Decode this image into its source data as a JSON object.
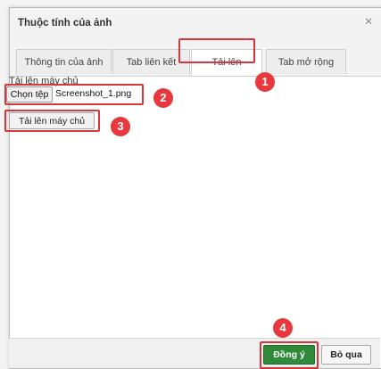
{
  "dialog": {
    "title": "Thuộc tính của ảnh",
    "close_glyph": "×",
    "close_icon": "close-icon"
  },
  "tabs": [
    {
      "label": "Thông tin của ảnh",
      "active": false
    },
    {
      "label": "Tab liên kết",
      "active": false
    },
    {
      "label": "Tải lên",
      "active": true
    },
    {
      "label": "Tab mở rộng",
      "active": false
    }
  ],
  "upload": {
    "label": "Tải lên máy chủ",
    "choose_button": "Chọn tệp",
    "file_name": "Screenshot_1.png",
    "server_button": "Tải lên máy chủ"
  },
  "footer": {
    "ok_label": "Đồng ý",
    "cancel_label": "Bỏ qua"
  },
  "step_badges": [
    "1",
    "2",
    "3",
    "4"
  ],
  "colors": {
    "highlight": "#d9363b",
    "badge": "#e8383d",
    "ok_button": "#2f8a3a"
  }
}
